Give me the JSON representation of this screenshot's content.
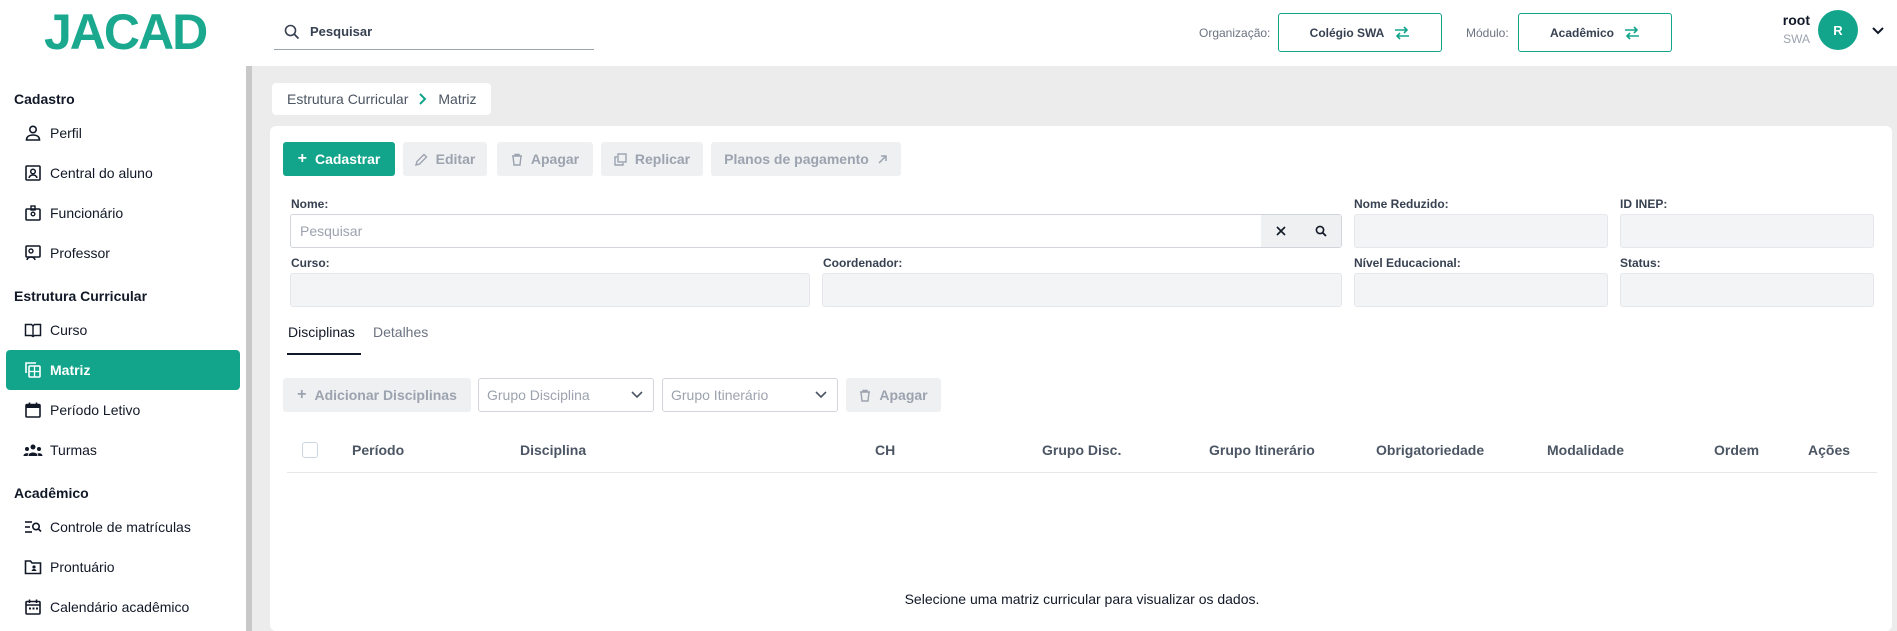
{
  "header": {
    "logo_text": "JACAD",
    "search_placeholder": "Pesquisar",
    "org_label": "Organização:",
    "org_value": "Colégio SWA",
    "module_label": "Módulo:",
    "module_value": "Acadêmico",
    "user_name": "root",
    "user_org": "SWA",
    "avatar_initial": "R"
  },
  "sidebar": {
    "sections": [
      {
        "title": "Cadastro",
        "items": [
          {
            "label": "Perfil",
            "icon": "person-icon"
          },
          {
            "label": "Central do aluno",
            "icon": "student-card-icon"
          },
          {
            "label": "Funcionário",
            "icon": "badge-icon"
          },
          {
            "label": "Professor",
            "icon": "teacher-icon"
          }
        ]
      },
      {
        "title": "Estrutura Curricular",
        "items": [
          {
            "label": "Curso",
            "icon": "book-icon"
          },
          {
            "label": "Matriz",
            "icon": "matrix-icon",
            "active": true
          },
          {
            "label": "Período Letivo",
            "icon": "calendar-icon"
          },
          {
            "label": "Turmas",
            "icon": "group-icon"
          }
        ]
      },
      {
        "title": "Acadêmico",
        "items": [
          {
            "label": "Controle de matrículas",
            "icon": "list-search-icon"
          },
          {
            "label": "Prontuário",
            "icon": "folder-person-icon"
          },
          {
            "label": "Calendário acadêmico",
            "icon": "calendar-icon"
          }
        ]
      }
    ]
  },
  "breadcrumb": {
    "parent": "Estrutura Curricular",
    "current": "Matriz"
  },
  "toolbar": {
    "cadastrar": "Cadastrar",
    "editar": "Editar",
    "apagar": "Apagar",
    "replicar": "Replicar",
    "planos": "Planos de pagamento"
  },
  "form": {
    "nome_label": "Nome:",
    "nome_placeholder": "Pesquisar",
    "nome_reduzido_label": "Nome Reduzido:",
    "id_inep_label": "ID INEP:",
    "curso_label": "Curso:",
    "coordenador_label": "Coordenador:",
    "nivel_label": "Nível Educacional:",
    "status_label": "Status:"
  },
  "tabs": {
    "disciplinas": "Disciplinas",
    "detalhes": "Detalhes"
  },
  "subtoolbar": {
    "adicionar": "Adicionar Disciplinas",
    "grupo_disciplina": "Grupo Disciplina",
    "grupo_itinerario": "Grupo Itinerário",
    "apagar": "Apagar"
  },
  "table": {
    "columns": [
      "Período",
      "Disciplina",
      "CH",
      "Grupo Disc.",
      "Grupo Itinerário",
      "Obrigatoriedade",
      "Modalidade",
      "Ordem",
      "Ações"
    ],
    "empty_message": "Selecione uma matriz curricular para visualizar os dados."
  },
  "colors": {
    "accent": "#12a58b",
    "logo": "#1aa98f"
  }
}
